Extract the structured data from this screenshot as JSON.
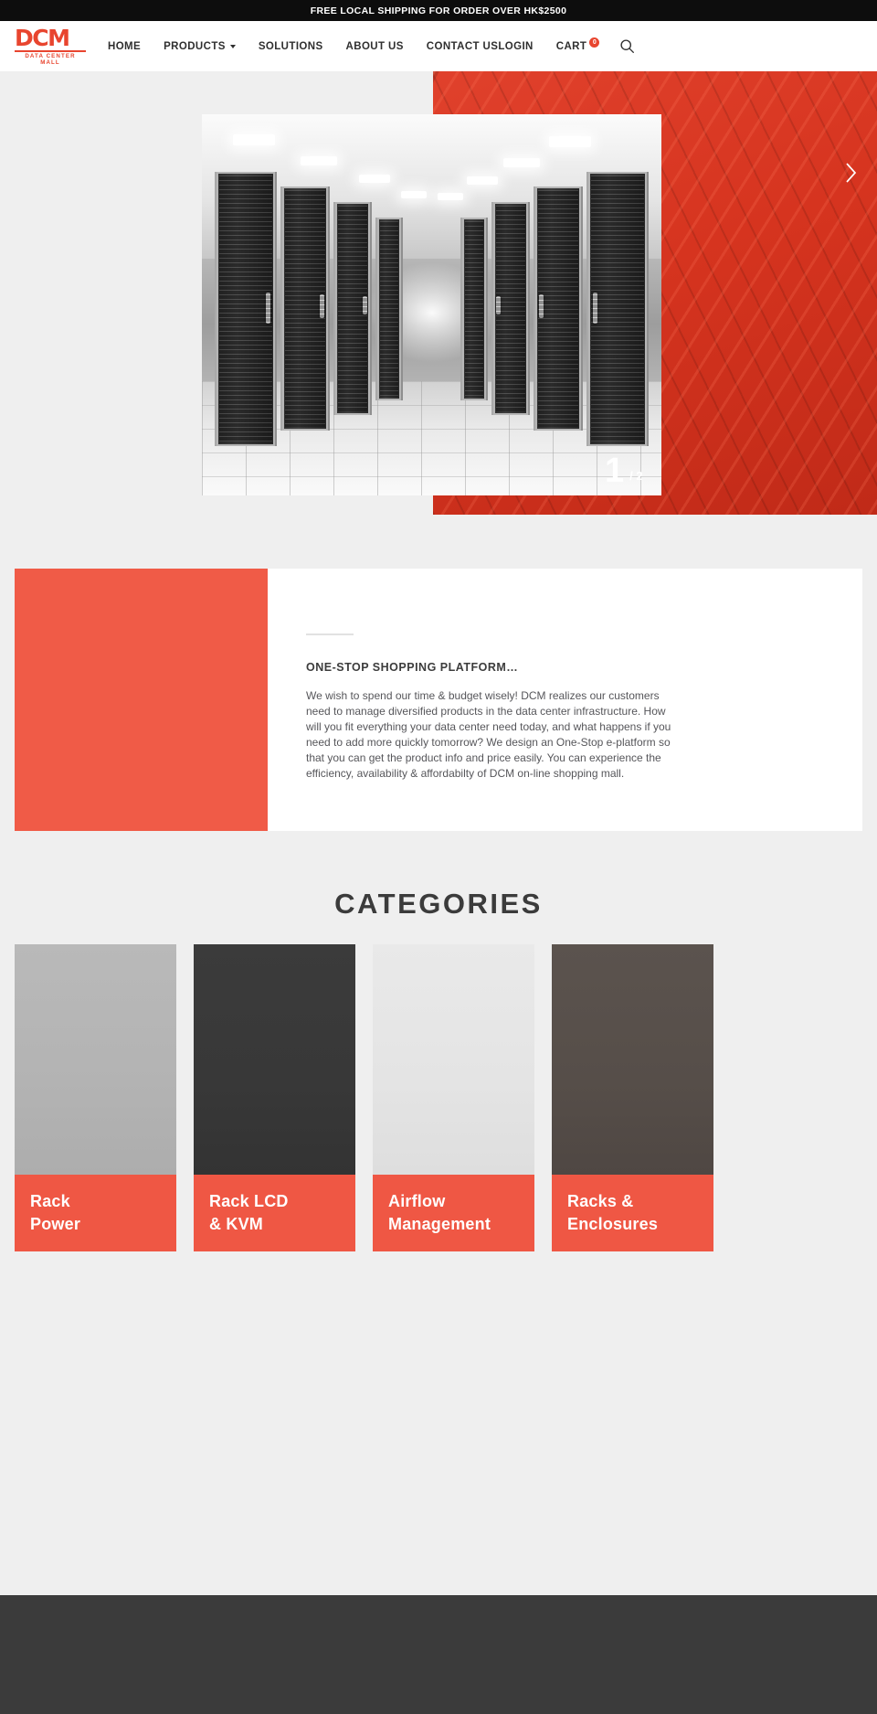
{
  "announcement": {
    "text": "FREE LOCAL SHIPPING FOR ORDER OVER HK$2500"
  },
  "header": {
    "logo": {
      "mark": "DCM",
      "subtitle": "DATA CENTER MALL"
    },
    "nav": [
      {
        "label": "HOME",
        "has_chevron": false
      },
      {
        "label": "PRODUCTS",
        "has_chevron": true
      },
      {
        "label": "SOLUTIONS",
        "has_chevron": false
      },
      {
        "label": "ABOUT US",
        "has_chevron": false
      },
      {
        "label": "CONTACT US",
        "has_chevron": false
      },
      {
        "label": "LOGIN",
        "has_chevron": false
      }
    ],
    "cart": {
      "label": "CART",
      "count": "0",
      "badge_color": "#e8452f"
    },
    "search_icon": "search-icon"
  },
  "hero": {
    "slide_current": "1",
    "slide_total": "/ 2",
    "next_icon": "chevron-right-icon",
    "photo_alt": "data-center-server-aisle",
    "accent_color": "#d6341f"
  },
  "intro": {
    "title": "ONE-STOP SHOPPING PLATFORM…",
    "body": "We wish to spend our time & budget wisely! DCM realizes our customers need to manage diversified products in the data center infrastructure. How will you fit everything your data center need today, and what happens if you need to add more quickly tomorrow? We design an One-Stop e-platform so that you can get the product info and price easily. You can experience the efficiency, availability & affordabilty of DCM on-line shopping mall.",
    "panel_color": "#f05b47"
  },
  "categories": {
    "heading": "CATEGORIES",
    "items": [
      {
        "label": "Rack\nPower",
        "line1": "Rack",
        "line2": "Power"
      },
      {
        "label": "Rack LCD\n& KVM",
        "line1": "Rack LCD",
        "line2": "& KVM"
      },
      {
        "label": "Airflow\nManagement",
        "line1": "Airflow",
        "line2": "Management"
      },
      {
        "label": "Racks &\nEnclosures",
        "line1": "Racks &",
        "line2": "Enclosures"
      }
    ],
    "label_color": "#ef5744"
  },
  "footer": {
    "background": "#3b3b3b"
  }
}
